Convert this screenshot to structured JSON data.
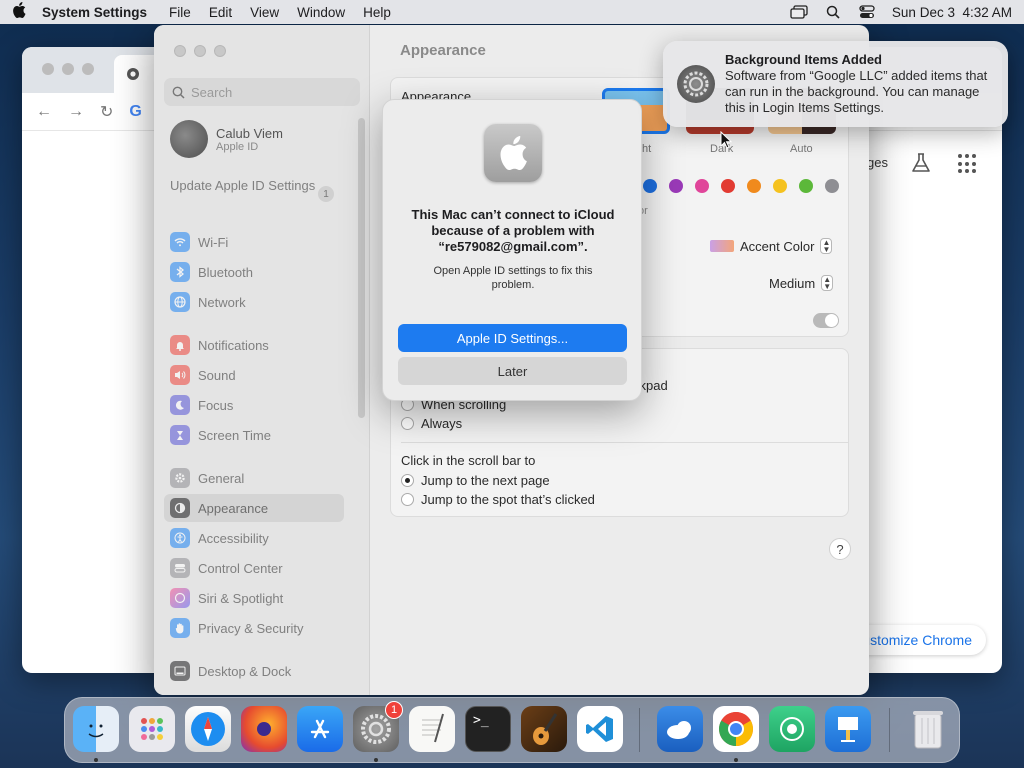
{
  "menubar": {
    "app_name": "System Settings",
    "items": [
      "File",
      "Edit",
      "View",
      "Window",
      "Help"
    ],
    "datetime": "Sun Dec 3  4:32 AM"
  },
  "chrome": {
    "right_label": "ges",
    "customize_label": "ustomize Chrome"
  },
  "settings": {
    "search_placeholder": "Search",
    "user_name": "Calub Viem",
    "user_sub": "Apple ID",
    "update_label": "Update Apple ID Settings",
    "update_count": "1",
    "sidebar": [
      {
        "label": "Wi-Fi",
        "icon": "wifi-icon",
        "color": "#1d84f5"
      },
      {
        "label": "Bluetooth",
        "icon": "bluetooth-icon",
        "color": "#1d84f5"
      },
      {
        "label": "Network",
        "icon": "globe-icon",
        "color": "#1d84f5"
      },
      {
        "label": "Notifications",
        "icon": "bell-icon",
        "color": "#f0443a"
      },
      {
        "label": "Sound",
        "icon": "speaker-icon",
        "color": "#f0443a"
      },
      {
        "label": "Focus",
        "icon": "moon-icon",
        "color": "#5856d6"
      },
      {
        "label": "Screen Time",
        "icon": "hourglass-icon",
        "color": "#5856d6"
      },
      {
        "label": "General",
        "icon": "gear-icon",
        "color": "#8e8e93"
      },
      {
        "label": "Appearance",
        "icon": "appearance-icon",
        "color": "#1d1d1f"
      },
      {
        "label": "Accessibility",
        "icon": "accessibility-icon",
        "color": "#1d84f5"
      },
      {
        "label": "Control Center",
        "icon": "control-center-icon",
        "color": "#8e8e93"
      },
      {
        "label": "Siri & Spotlight",
        "icon": "siri-icon",
        "color": "#c54bd8"
      },
      {
        "label": "Privacy & Security",
        "icon": "hand-icon",
        "color": "#1d84f5"
      },
      {
        "label": "Desktop & Dock",
        "icon": "dock-icon",
        "color": "#1d1d1f"
      }
    ],
    "pane_title": "Appearance",
    "appearance_label": "Appearance",
    "themes": [
      "ht",
      "Dark",
      "Auto"
    ],
    "accent_sub": "or",
    "accent_color_label": "Accent Color",
    "sidebar_icon_size": "Medium",
    "show_scroll_partial": "ckpad",
    "scroll_options": [
      "When scrolling",
      "Always"
    ],
    "click_scroll_label": "Click in the scroll bar to",
    "click_options": [
      "Jump to the next page",
      "Jump to the spot that’s clicked"
    ],
    "help": "?"
  },
  "alert": {
    "title": "This Mac can’t connect to iCloud because of a problem with “re579082@gmail.com”.",
    "message": "Open Apple ID settings to fix this problem.",
    "primary": "Apple ID Settings...",
    "secondary": "Later"
  },
  "notification": {
    "title": "Background Items Added",
    "body": "Software from “Google LLC” added items that can run in the background. You can manage this in Login Items Settings."
  },
  "dock": {
    "settings_badge": "1",
    "apps": [
      "finder",
      "launchpad",
      "safari",
      "firefox",
      "app-store",
      "system-settings",
      "textedit",
      "terminal",
      "garageband",
      "vscode",
      "weather",
      "chrome",
      "findmy",
      "keynote",
      "trash"
    ]
  }
}
